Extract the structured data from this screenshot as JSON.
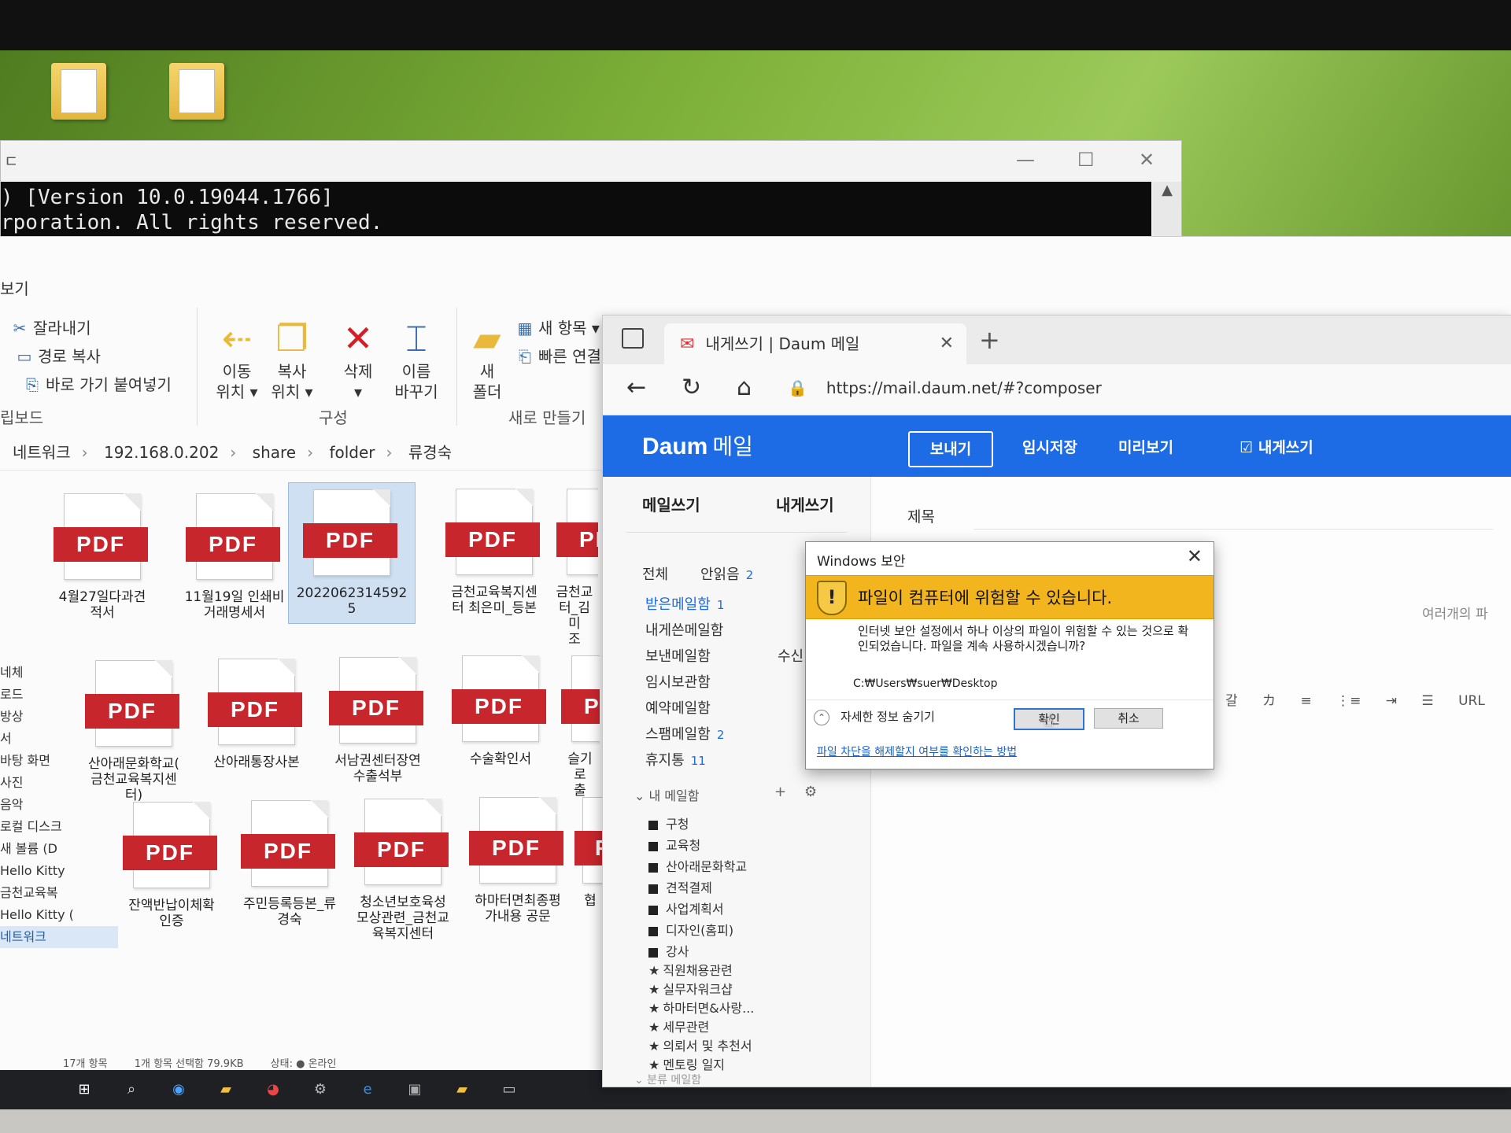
{
  "cmd": {
    "title": "ㄷ",
    "line1": ") [Version 10.0.19044.1766]",
    "line2": "rporation. All rights reserved.",
    "minimize": "—",
    "maximize": "☐",
    "close": "✕"
  },
  "explorer": {
    "menu_tab": "보기",
    "clipboard": {
      "cut": "잘라내기",
      "copy_path": "경로 복사",
      "paste_shortcut": "바로 가기 붙여넣기",
      "group": "립보드"
    },
    "organize": {
      "move_to": "이동\n위치 ▾",
      "copy_to": "복사\n위치 ▾",
      "delete": "삭제\n▾",
      "rename": "이름\n바꾸기",
      "group": "구성"
    },
    "new": {
      "new_folder": "새\n폴더",
      "new_item": "새 항목 ▾",
      "quick_access": "빠른 연결",
      "group": "새로 만들기"
    },
    "breadcrumb": [
      "네트워크",
      "192.168.0.202",
      "share",
      "folder",
      "류경숙"
    ],
    "files": [
      "4월27일다과견\n적서",
      "11월19일 인쇄비\n거래명세서",
      "2022062314592\n5",
      "금천교육복지센\n터 최은미_등본",
      "금천교\n터_김미\n조",
      "산아래문화학교(\n금천교육복지센\n터)",
      "산아래통장사본",
      "서남권센터장연\n수출석부",
      "수술확인서",
      "슬기로\n출",
      "잔액반납이체확\n인증",
      "주민등록등본_류\n경숙",
      "청소년보호육성\n모상관련_금천교\n육복지센터",
      "하마터면최종평\n가내용 공문",
      "협"
    ],
    "nav": [
      "네체",
      "로드",
      "방상",
      "서",
      "바탕 화면",
      "사진",
      "음악",
      "로컬 디스크",
      "새 볼륨 (D",
      "Hello Kitty",
      "금천교육복",
      "Hello Kitty (",
      "네트워크"
    ],
    "status": [
      "17개 항목",
      "1개 항목 선택함 79.9KB",
      "상태: ● 온라인"
    ]
  },
  "browser": {
    "tab_title": "내게쓰기 | Daum 메일",
    "tab_close": "✕",
    "new_tab": "+",
    "url": "https://mail.daum.net/#?composer",
    "nav": {
      "back": "←",
      "refresh": "↻",
      "home": "⌂",
      "lock": "🔒"
    }
  },
  "daum": {
    "logo": "Daum",
    "service": "메일",
    "buttons": {
      "send": "보내기",
      "save_draft": "임시저장",
      "preview": "미리보기",
      "to_me": "☑ 내게쓰기"
    },
    "left_tabs": {
      "compose": "메일쓰기",
      "to_me": "내게쓰기"
    },
    "filters": {
      "all": "전체",
      "unread": "안읽음",
      "unread_count": "2"
    },
    "mailboxes": [
      {
        "name": "받은메일함",
        "count": "1"
      },
      {
        "name": "내게쓴메일함",
        "count": ""
      },
      {
        "name": "보낸메일함",
        "count": ""
      },
      {
        "name": "임시보관함",
        "count": ""
      },
      {
        "name": "예약메일함",
        "count": ""
      },
      {
        "name": "스팸메일함",
        "count": "2"
      },
      {
        "name": "휴지통",
        "count": "11"
      }
    ],
    "receive_label": "수신",
    "my_mailbox_label": "⌄ 내 메일함",
    "my_mailbox_add": "+",
    "my_mailbox_settings": "⚙",
    "folders_square": [
      "구청",
      "교육청",
      "산아래문화학교",
      "견적결제",
      "사업계획서",
      "디자인(홈피)",
      "강사"
    ],
    "folders_star": [
      "직원채용관련",
      "실무자워크샵",
      "하마터면&사랑...",
      "세무관련",
      "의뢰서 및 추천서",
      "멘토링 일지"
    ],
    "bottom_label": "⌄ 분류 메일함",
    "subject_label": "제목",
    "multi_file_hint": "여러개의 파",
    "editor_tools": [
      "갈",
      "カ",
      "≡",
      "⋮≡",
      "⇥",
      "☰",
      "URL",
      "🖼"
    ]
  },
  "security_dialog": {
    "title": "Windows 보안",
    "close": "✕",
    "heading": "파일이 컴퓨터에 위험할 수 있습니다.",
    "body": "인터넷 보안 설정에서 하나 이상의 파일이 위험할 수 있는 것으로 확인되었습니다. 파일을 계속 사용하시겠습니까?",
    "path": "C:₩Users₩suer₩Desktop",
    "toggle": "자세한 정보 숨기기",
    "ok": "확인",
    "cancel": "취소",
    "help_link": "파일 차단을 해제할지 여부를 확인하는 방법"
  }
}
